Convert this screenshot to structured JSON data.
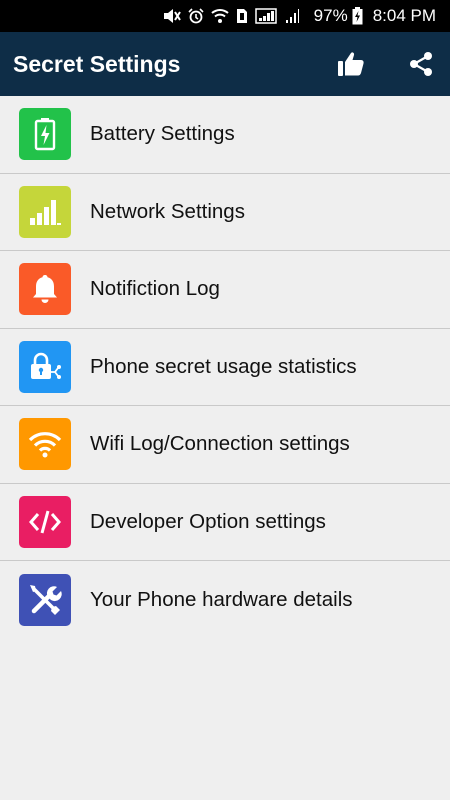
{
  "status_bar": {
    "battery_percent": "97%",
    "time": "8:04 PM"
  },
  "app_bar": {
    "title": "Secret Settings",
    "like_icon": "thumbs-up-icon",
    "share_icon": "share-icon",
    "background_color": "#0e2d47"
  },
  "items": [
    {
      "label": "Battery Settings",
      "icon": "battery-icon",
      "color": "#22c24a"
    },
    {
      "label": "Network Settings",
      "icon": "signal-bars-icon",
      "color": "#c5d63a"
    },
    {
      "label": "Notifiction Log",
      "icon": "bell-icon",
      "color": "#fa5a28"
    },
    {
      "label": "Phone secret usage statistics",
      "icon": "lock-usage-icon",
      "color": "#2196f3"
    },
    {
      "label": "Wifi Log/Connection settings",
      "icon": "wifi-icon",
      "color": "#ff9800"
    },
    {
      "label": "Developer Option settings",
      "icon": "code-icon",
      "color": "#e91e63"
    },
    {
      "label": "Your Phone hardware details",
      "icon": "tools-icon",
      "color": "#3f51b5"
    }
  ]
}
